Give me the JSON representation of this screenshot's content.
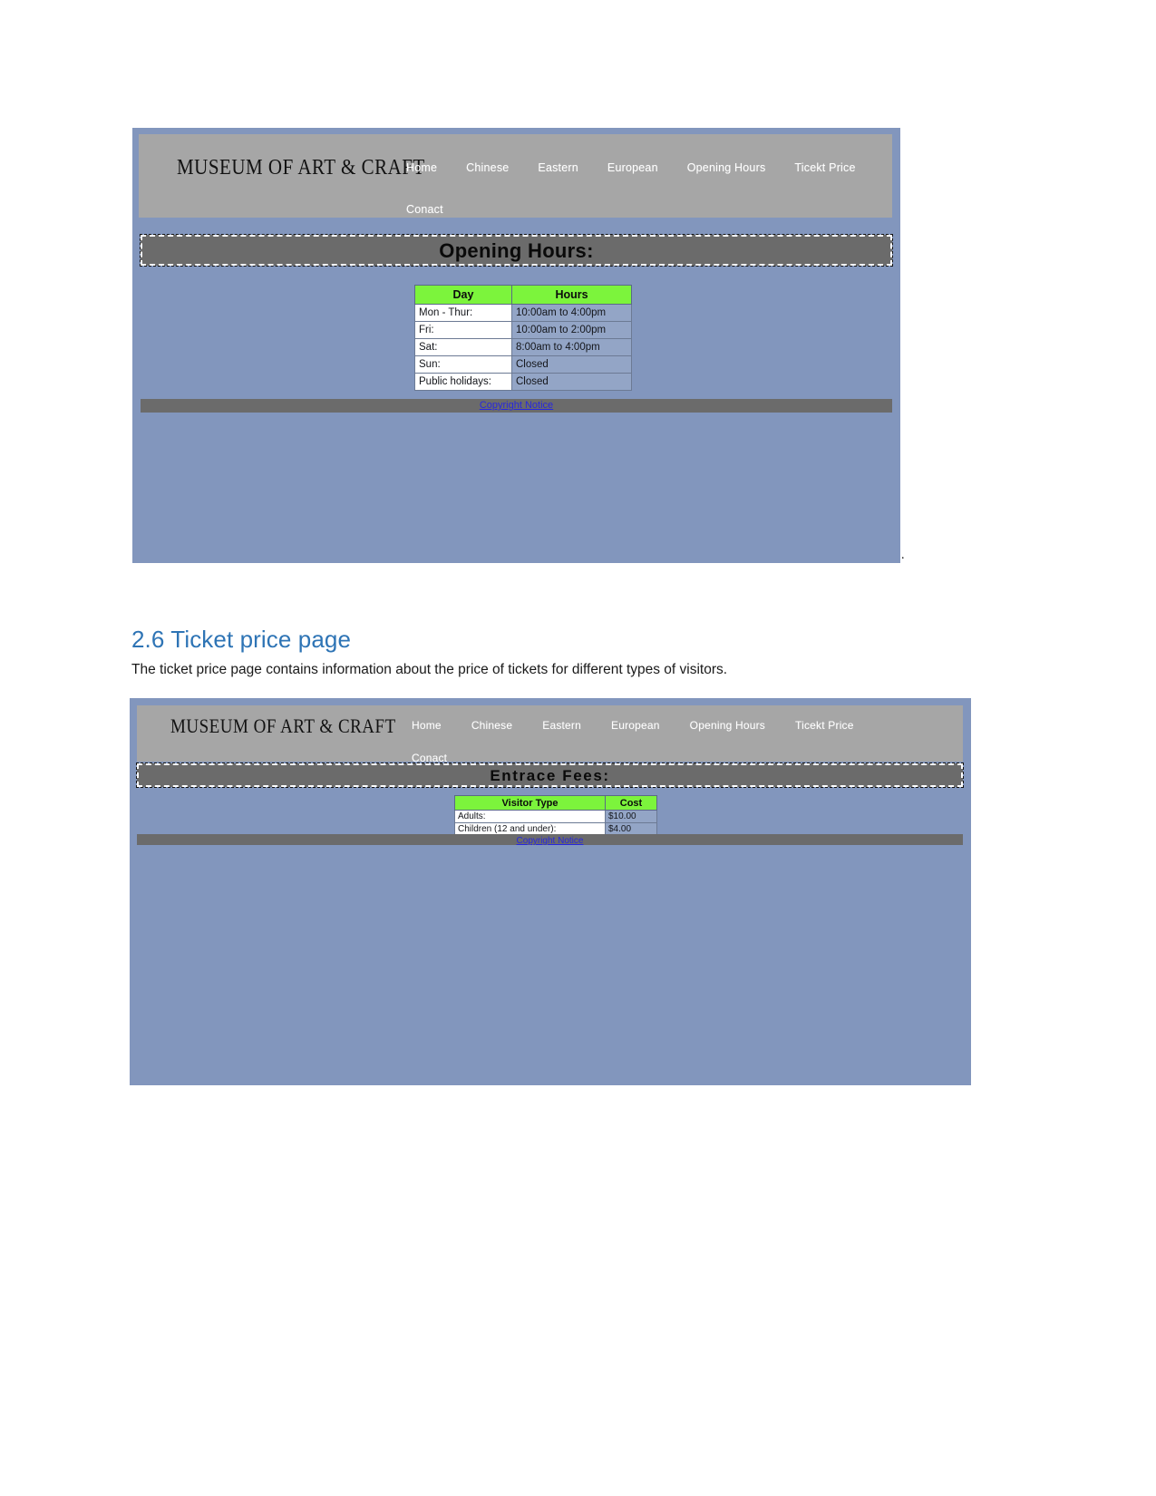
{
  "document": {
    "section_heading": "2.6 Ticket price page",
    "section_paragraph": "The ticket price page contains information about the price of tickets for different types of visitors.",
    "trailing_punctuation": "."
  },
  "site": {
    "brand": "MUSEUM OF ART & CRAFT",
    "nav": [
      "Home",
      "Chinese",
      "Eastern",
      "European",
      "Opening Hours",
      "Ticekt Price",
      "Conact"
    ],
    "footer_link": "Copyright Notice",
    "colors": {
      "page_background": "#8296bd",
      "header_background": "#a6a6a6",
      "heading_band": "#6b6b6b",
      "table_header_green": "#7cf43c",
      "link_blue": "#2727e0",
      "doc_heading_blue": "#2e74b5"
    }
  },
  "screenshot_opening_hours": {
    "heading": "Opening Hours:",
    "table": {
      "columns": [
        "Day",
        "Hours"
      ],
      "rows": [
        [
          "Mon - Thur:",
          "10:00am to 4:00pm"
        ],
        [
          "Fri:",
          "10:00am to 2:00pm"
        ],
        [
          "Sat:",
          "8:00am to 4:00pm"
        ],
        [
          "Sun:",
          "Closed"
        ],
        [
          "Public holidays:",
          "Closed"
        ]
      ]
    }
  },
  "screenshot_ticket_price": {
    "heading": "Entrace Fees:",
    "table": {
      "columns": [
        "Visitor Type",
        "Cost"
      ],
      "rows": [
        [
          "Adults:",
          "$10.00"
        ],
        [
          "Children (12 and under):",
          "$4.00"
        ]
      ]
    }
  }
}
